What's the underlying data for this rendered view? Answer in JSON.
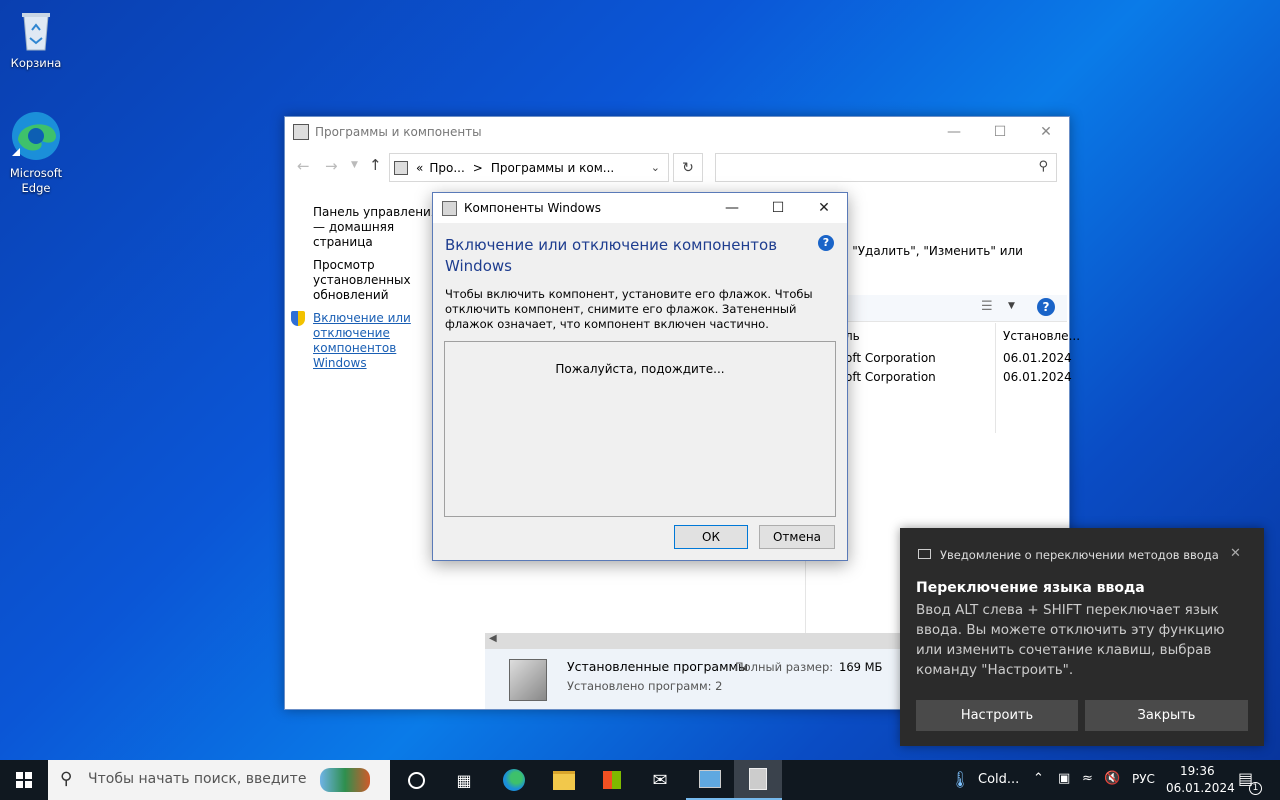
{
  "desktop": {
    "icons": [
      {
        "label": "Корзина"
      },
      {
        "label": "Microsoft Edge"
      }
    ]
  },
  "main_window": {
    "title": "Программы и компоненты",
    "breadcrumb_sep": "«",
    "breadcrumb_1": "Про...",
    "breadcrumb_arrow": ">",
    "breadcrumb_2": "Программы и ком...",
    "left_links": {
      "home": "Панель управления — домашняя страница",
      "updates": "Просмотр установленных обновлений",
      "features": "Включение или отключение компонентов Windows"
    },
    "hint_text": "е \"Удалить\", \"Изменить\" или",
    "columns": {
      "publisher": "ль",
      "installed": "Установле..."
    },
    "rows": [
      {
        "publisher": "oft Corporation",
        "date": "06.01.2024"
      },
      {
        "publisher": "oft Corporation",
        "date": "06.01.2024"
      }
    ],
    "status": {
      "title": "Установленные программы",
      "size_label": "Полный размер:",
      "size_value": "169 МБ",
      "count": "Установлено программ: 2"
    }
  },
  "dialog": {
    "title": "Компоненты Windows",
    "heading": "Включение или отключение компонентов Windows",
    "description": "Чтобы включить компонент, установите его флажок. Чтобы отключить компонент, снимите его флажок. Затененный флажок означает, что компонент включен частично.",
    "loading": "Пожалуйста, подождите...",
    "ok": "ОК",
    "cancel": "Отмена"
  },
  "toast": {
    "app": "Уведомление о переключении методов ввода",
    "title": "Переключение языка ввода",
    "body": "Ввод ALT слева + SHIFT переключает язык ввода. Вы можете отключить эту функцию или изменить сочетание клавиш, выбрав команду \"Настроить\".",
    "btn_configure": "Настроить",
    "btn_close": "Закрыть"
  },
  "taskbar": {
    "search_placeholder": "Чтобы начать поиск, введите",
    "weather": "Cold...",
    "lang": "РУС",
    "time": "19:36",
    "date": "06.01.2024",
    "notif_count": "1"
  },
  "colors": {
    "accent": "#1a5fb4",
    "heading": "#1e3d8f",
    "taskbar": "#101820",
    "toast": "#2b2b2b"
  }
}
